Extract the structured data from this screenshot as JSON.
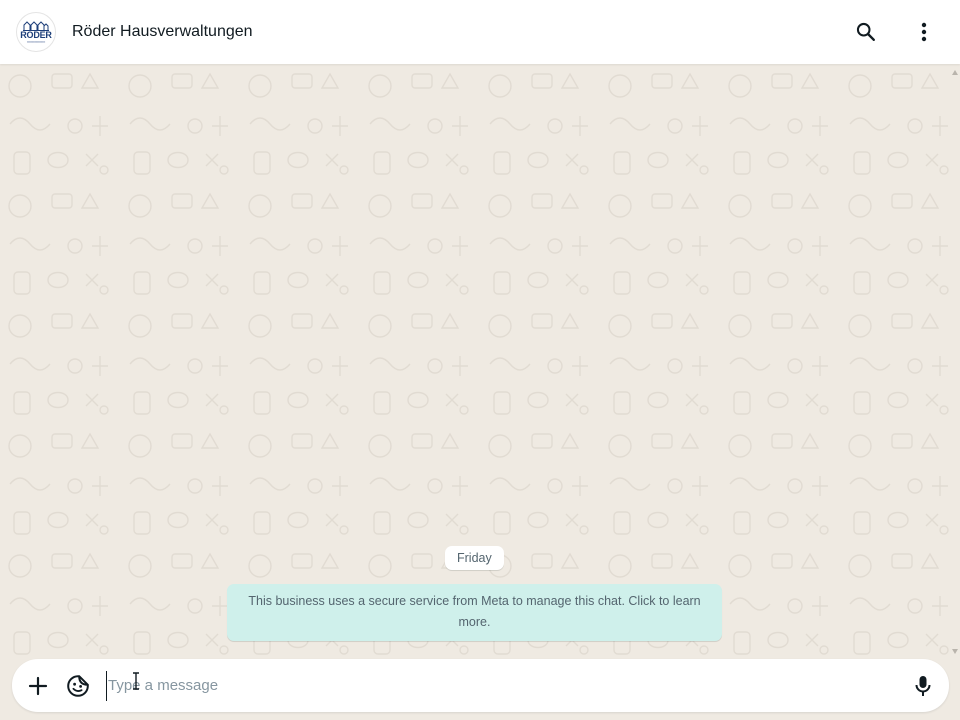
{
  "header": {
    "chat_title": "Röder Hausverwaltungen",
    "avatar_logo_text": "RÖDER",
    "search_icon": "search-icon",
    "menu_icon": "more-vertical-icon"
  },
  "chat": {
    "date_label": "Friday",
    "system_notice": "This business uses a secure service from Meta to manage this chat. Click to learn more."
  },
  "composer": {
    "placeholder": "Type a message",
    "value": "",
    "attach_icon": "plus-icon",
    "sticker_icon": "sticker-icon",
    "mic_icon": "microphone-icon"
  },
  "colors": {
    "header_bg": "#ffffff",
    "chat_bg": "#efeae2",
    "notice_bg": "#cff0eb",
    "date_chip_bg": "#ffffff",
    "icon_color": "#111b21",
    "secondary_text": "#54656f"
  }
}
